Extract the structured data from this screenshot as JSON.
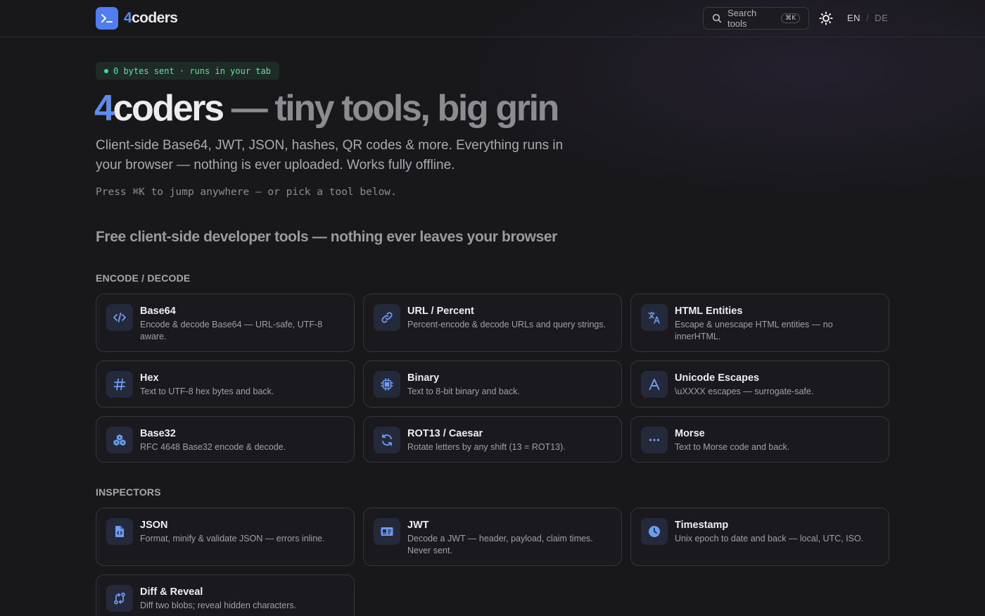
{
  "header": {
    "logo_accent": "4",
    "logo_rest": "coders",
    "search_label": "Search tools",
    "search_shortcut": "⌘K",
    "lang_en": "EN",
    "lang_sep": "/",
    "lang_de": "DE"
  },
  "hero": {
    "badge": "0 bytes sent · runs in your tab",
    "title_accent": "4",
    "title_brand": "coders",
    "title_rest": " — tiny tools, big grin",
    "subtitle": "Client-side Base64, JWT, JSON, hashes, QR codes & more. Everything runs in your browser — nothing is ever uploaded. Works fully offline.",
    "hint": "Press ⌘K to jump anywhere — or pick a tool below."
  },
  "section_heading": "Free client-side developer tools — nothing ever leaves your browser",
  "categories": [
    {
      "label": "ENCODE / DECODE",
      "tools": [
        {
          "title": "Base64",
          "desc": "Encode & decode Base64 — URL-safe, UTF-8 aware.",
          "icon": "code-icon"
        },
        {
          "title": "URL / Percent",
          "desc": "Percent-encode & decode URLs and query strings.",
          "icon": "link-icon"
        },
        {
          "title": "HTML Entities",
          "desc": "Escape & unescape HTML entities — no innerHTML.",
          "icon": "translate-icon"
        },
        {
          "title": "Hex",
          "desc": "Text to UTF-8 hex bytes and back.",
          "icon": "hash-icon"
        },
        {
          "title": "Binary",
          "desc": "Text to 8-bit binary and back.",
          "icon": "chip-icon"
        },
        {
          "title": "Unicode Escapes",
          "desc": "\\uXXXX escapes — surrogate-safe.",
          "icon": "letter-a-icon"
        },
        {
          "title": "Base32",
          "desc": "RFC 4648 Base32 encode & decode.",
          "icon": "cubes-icon"
        },
        {
          "title": "ROT13 / Caesar",
          "desc": "Rotate letters by any shift (13 = ROT13).",
          "icon": "refresh-icon"
        },
        {
          "title": "Morse",
          "desc": "Text to Morse code and back.",
          "icon": "dots-icon"
        }
      ]
    },
    {
      "label": "INSPECTORS",
      "tools": [
        {
          "title": "JSON",
          "desc": "Format, minify & validate JSON — errors inline.",
          "icon": "file-code-icon"
        },
        {
          "title": "JWT",
          "desc": "Decode a JWT — header, payload, claim times. Never sent.",
          "icon": "id-card-icon"
        },
        {
          "title": "Timestamp",
          "desc": "Unix epoch to date and back — local, UTC, ISO.",
          "icon": "clock-icon"
        },
        {
          "title": "Diff & Reveal",
          "desc": "Diff two blobs; reveal hidden characters.",
          "icon": "diff-icon"
        }
      ]
    }
  ],
  "colors": {
    "accent": "#4f7df2",
    "badge_green": "#3ddc97",
    "icon_blue": "#5b8def"
  }
}
